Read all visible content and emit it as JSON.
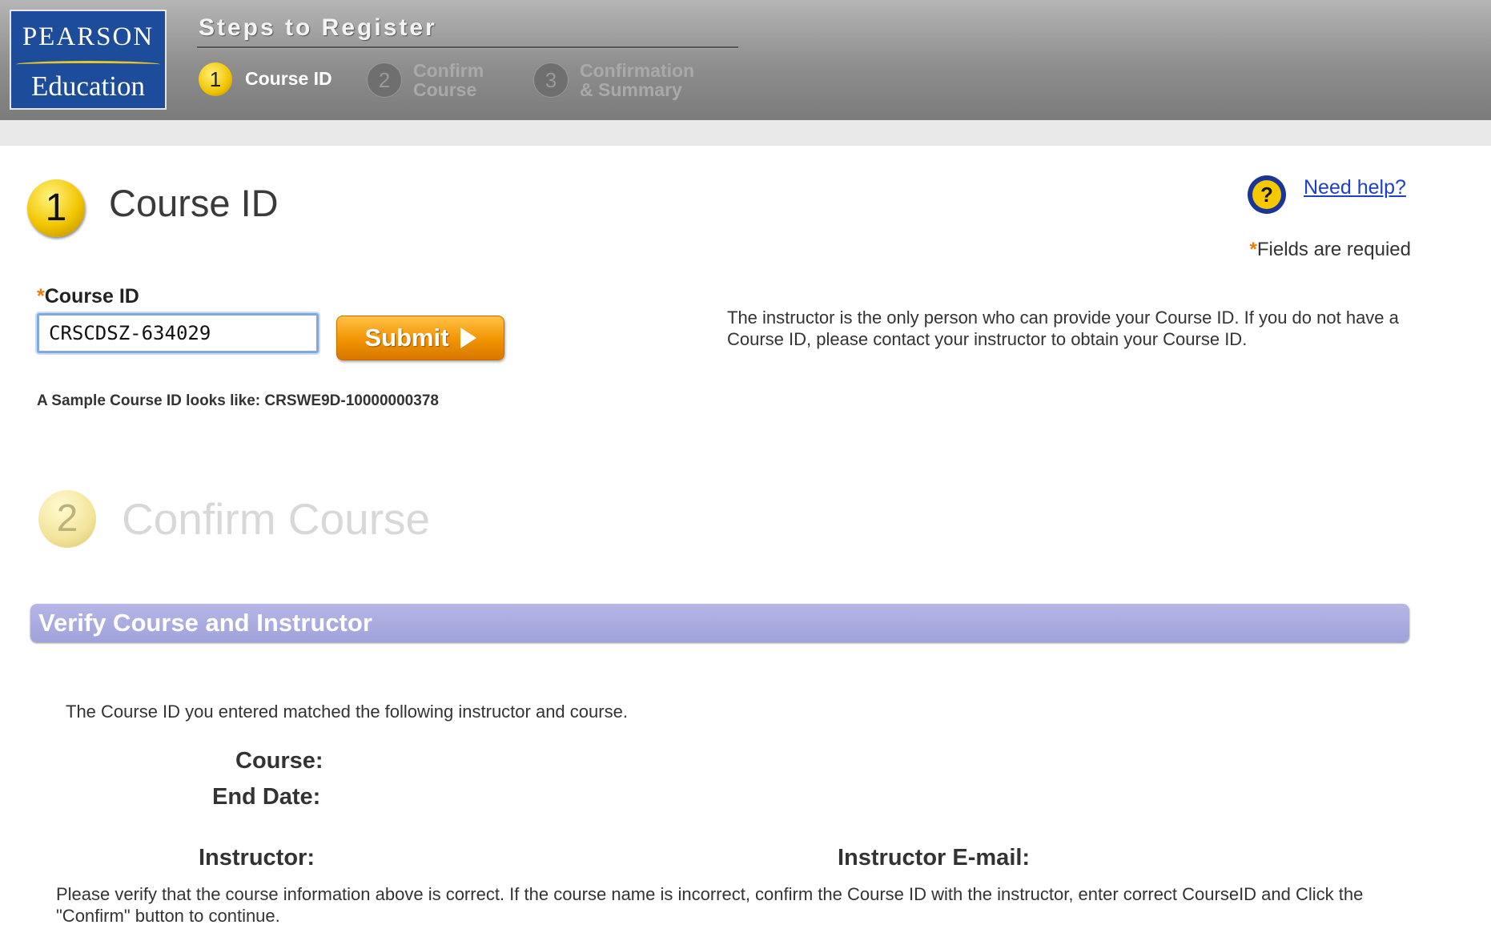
{
  "logo": {
    "line1": "PEARSON",
    "line2": "Education"
  },
  "steps": {
    "title": "Steps to Register",
    "items": [
      {
        "num": "1",
        "label": "Course ID",
        "state": "active"
      },
      {
        "num": "2",
        "label_line1": "Confirm",
        "label_line2": "Course",
        "state": "inactive"
      },
      {
        "num": "3",
        "label_line1": "Confirmation",
        "label_line2": "& Summary",
        "state": "inactive"
      }
    ]
  },
  "section1": {
    "num": "1",
    "title": "Course ID",
    "help_link": "Need help?",
    "required_star": "*",
    "required_note": "Fields are requied",
    "field_star": "*",
    "field_label": "Course ID",
    "field_value": "CRSCDSZ-634029",
    "submit_label": "Submit",
    "sample_text": "A Sample Course ID looks like: CRSWE9D-10000000378",
    "info_text": "The instructor is the only person who can provide your Course ID. If you do not have a Course ID, please contact your instructor to obtain your Course ID."
  },
  "section2": {
    "num": "2",
    "title": "Confirm Course",
    "bar_title": "Verify Course and Instructor",
    "matched_text": "The Course ID you entered matched the following instructor and course.",
    "course_label": "Course:",
    "end_date_label": "End Date:",
    "instructor_label": "Instructor:",
    "instructor_email_label": "Instructor E-mail:",
    "verify_text": "Please verify that the course information above is correct. If the course name is incorrect, confirm the Course ID with the instructor, enter correct CourseID and Click the \"Confirm\" button to continue."
  },
  "colors": {
    "accent_orange": "#f29300",
    "step_yellow": "#f2c500",
    "link_blue": "#1f3fc7",
    "verify_bar": "#a6a8de",
    "header_gray": "#8e8e8e"
  },
  "icons": [
    "help-icon",
    "play-triangle-icon",
    "step-number-badge"
  ]
}
